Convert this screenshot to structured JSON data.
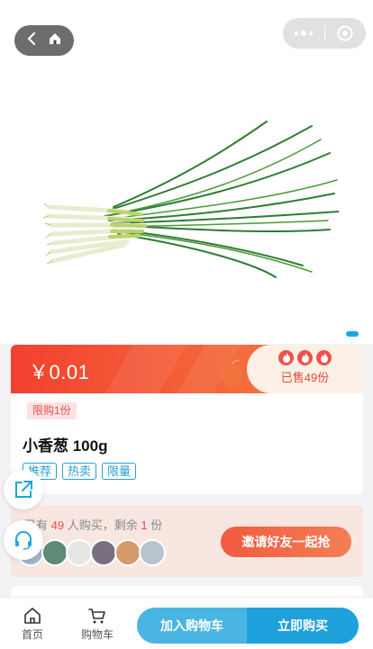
{
  "hero": {
    "image": "spring-onion-photo"
  },
  "nav": {
    "back_icon": "chevron-left-icon",
    "home_icon": "home-icon",
    "menu_icon": "more-dots-icon",
    "close_icon": "target-circle-icon"
  },
  "product": {
    "price": "￥0.01",
    "sold": "已售49份",
    "limit": "限购1份",
    "name": "小香葱 100g",
    "tags": [
      "推荐",
      "热卖",
      "限量"
    ]
  },
  "group_buy": {
    "prefix": "已有",
    "buyers": "49",
    "middle": "人购买，剩余",
    "remaining": "1",
    "suffix": "份",
    "invite_label": "邀请好友一起抢"
  },
  "bottom_bar": {
    "home_label": "首页",
    "cart_label": "购物车",
    "add_to_cart": "加入购物车",
    "buy_now": "立即购买"
  },
  "colors": {
    "accent_red": "#f2412f",
    "accent_blue": "#1ea1db"
  }
}
